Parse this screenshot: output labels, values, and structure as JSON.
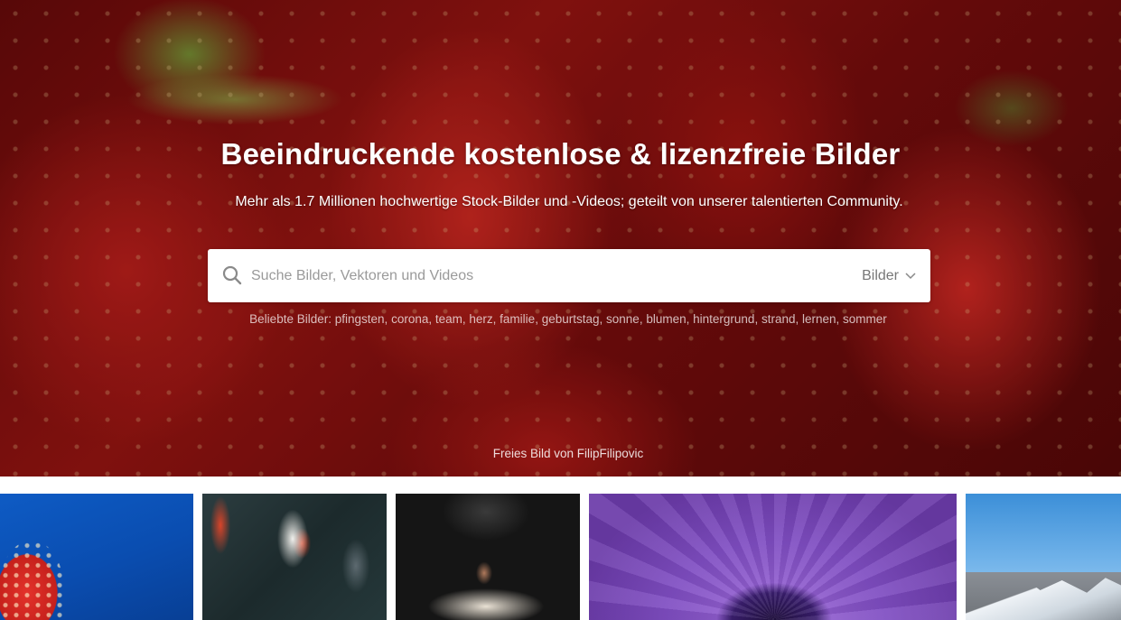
{
  "hero": {
    "title": "Beeindruckende kostenlose & lizenzfreie Bilder",
    "subtitle": "Mehr als 1.7 Millionen hochwertige Stock-Bilder und -Videos; geteilt von unserer talentierten Community.",
    "search": {
      "placeholder": "Suche Bilder, Vektoren und Videos",
      "value": "",
      "icon": "search-icon",
      "type_selected": "Bilder"
    },
    "popular": {
      "label": "Beliebte Bilder:",
      "tags": [
        "pfingsten",
        "corona",
        "team",
        "herz",
        "familie",
        "geburtstag",
        "sonne",
        "blumen",
        "hintergrund",
        "strand",
        "lernen",
        "sommer"
      ]
    },
    "credit": {
      "prefix": "Freies Bild von",
      "author": "FilipFilipovic"
    }
  },
  "thumbnails": [
    {
      "subject": "strawberry-blue-background"
    },
    {
      "subject": "koi-fish"
    },
    {
      "subject": "dancer"
    },
    {
      "subject": "purple-anemone"
    },
    {
      "subject": "snowy-mountains"
    }
  ]
}
